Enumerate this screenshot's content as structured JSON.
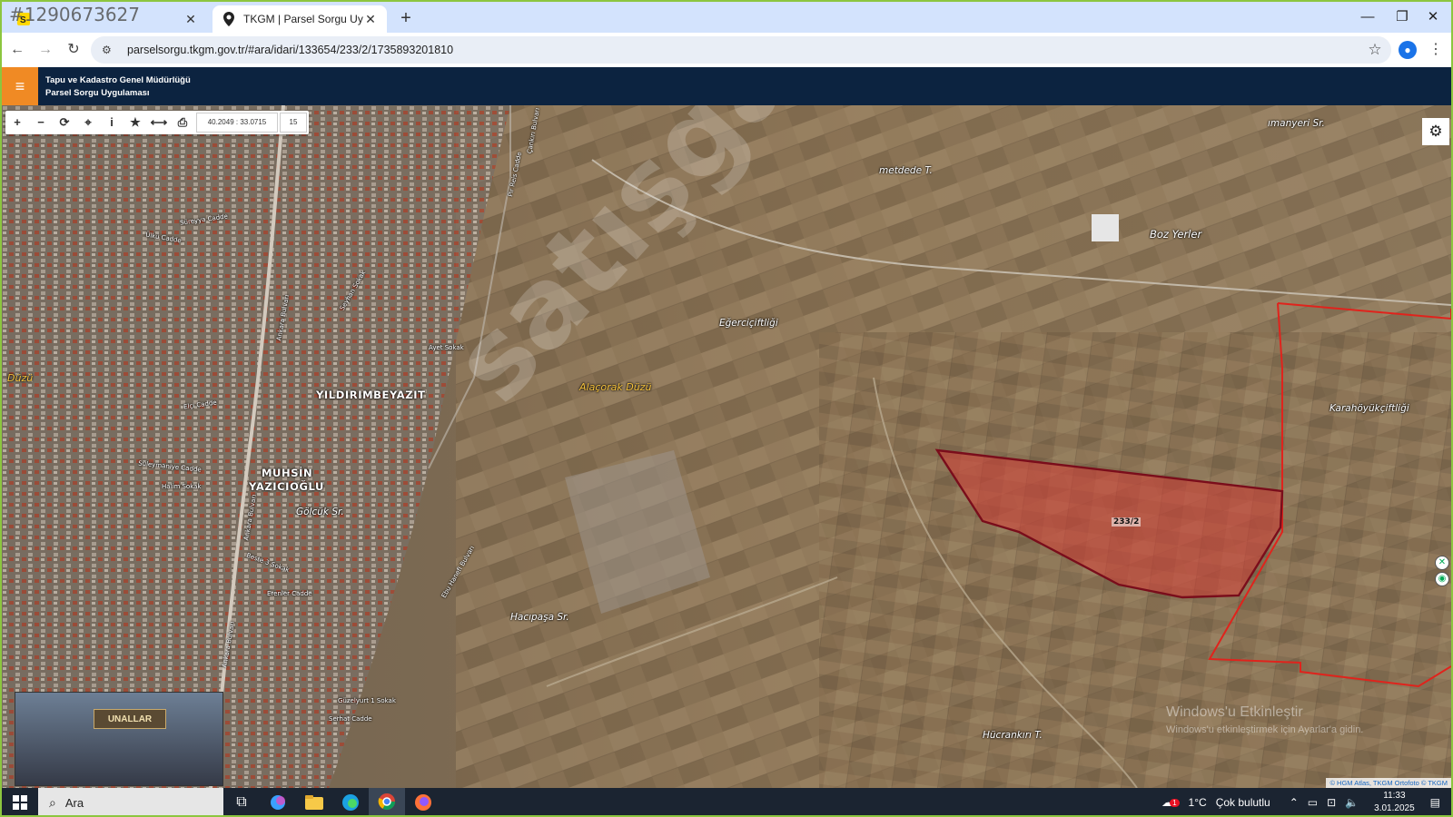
{
  "overlay_badge": "#1290673627",
  "browser": {
    "tabs": [
      {
        "title": "",
        "icon": "sahibinden-favicon"
      },
      {
        "title": "TKGM | Parsel Sorgu Uygulaması",
        "icon": "location-pin-icon",
        "active": true
      }
    ],
    "url": "parselsorgu.tkgm.gov.tr/#ara/idari/133654/233/2/1735893201810"
  },
  "app": {
    "org_line1": "Tapu ve Kadastro Genel Müdürlüğü",
    "org_line2": "Parsel Sorgu Uygulaması",
    "coords": "40.2049 : 33.0715",
    "zoom": "15"
  },
  "map": {
    "parcel_label": "233/2",
    "labels": {
      "manyeri": "ımanyeri Sr.",
      "metdede": "metdede T.",
      "boz_yerler": "Boz Yerler",
      "egerci": "Eğerciçiftliği",
      "alacorak": "Alaçorak Düzü",
      "karahoyuk": "Karahöyükçiftliği",
      "yildirim": "YILDIRIMBEYAZIT",
      "muhsin": "MUHSİN",
      "yazicioglu": "YAZICIOĞLU",
      "golcuk": "Gölcük Sr.",
      "hacipasa": "Hacıpaşa Sr.",
      "hucrankiri": "Hücrankırı T.",
      "duzu": "Düzü",
      "ankara_bulvari": "Ankara Bulvarı",
      "ankara_bulvari2": "Ankara Bulvarı",
      "ankara_bulvari3": "Ankara Bulvarı",
      "sureyya": "Süreyya Cadde",
      "uku": "Ülkü Cadde",
      "cankiri": "Çankırı Bulvarı",
      "pir_reis": "Pir Reis Cadde",
      "akbeyaz": "Akbeyaz Sokak",
      "ayet": "Ayet Sokak",
      "ebru": "Ebu Hanefi Bulvarı",
      "erenler": "Erenler Cadde",
      "serhat": "Serhat Cadde",
      "guzelyurt": "Güzelyurt 1 Sokak",
      "eci": "Elçi Cadde",
      "suleymaniye": "Süleymaniye Cadde",
      "halim": "Halim Sokak",
      "beste": "Beste 3 Sokak",
      "seyhan": "Seyhan Sokak"
    },
    "watermark": "satışgaranti",
    "windows_activation": "Windows'u Etkinleştir",
    "windows_activation_sub": "Windows'u etkinleştirmek için Ayarlar'a gidin.",
    "thumbnail_sign": "UNALLAR",
    "attribution": "© HGM Atlas, TKGM Ortofoto © TKGM"
  },
  "taskbar": {
    "search_placeholder": "Ara",
    "weather_temp": "1°C",
    "weather_text": "Çok bulutlu",
    "time": "11:33",
    "date": "3.01.2025",
    "notification_count": "1"
  }
}
